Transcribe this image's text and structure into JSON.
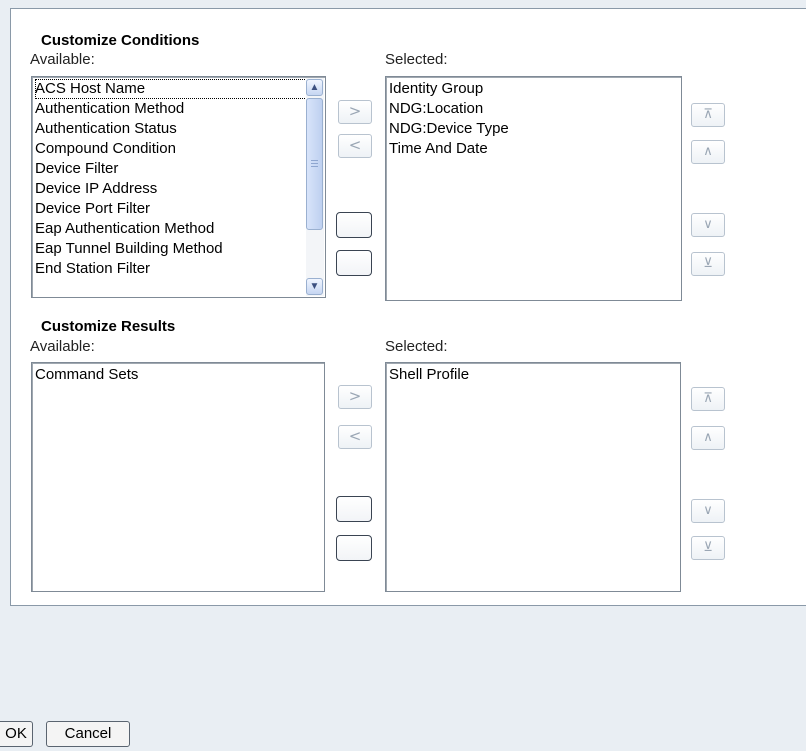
{
  "conditions": {
    "title": "Customize Conditions",
    "available_label": "Available:",
    "selected_label": "Selected:",
    "available_items": [
      "ACS Host Name",
      "Authentication Method",
      "Authentication Status",
      "Compound Condition",
      "Device Filter",
      "Device IP Address",
      "Device Port Filter",
      "Eap Authentication Method",
      "Eap Tunnel Building Method",
      "End Station Filter"
    ],
    "selected_items": [
      "Identity Group",
      "NDG:Location",
      "NDG:Device Type",
      "Time And Date"
    ],
    "focused_item": "ACS Host Name"
  },
  "results": {
    "title": "Customize Results",
    "available_label": "Available:",
    "selected_label": "Selected:",
    "available_items": [
      "Command Sets"
    ],
    "selected_items": [
      "Shell Profile"
    ]
  },
  "buttons": {
    "add": ">",
    "remove": "<",
    "move_top": "⊼",
    "move_up": "∧",
    "move_down": "∨",
    "move_bottom": "⊻"
  },
  "footer": {
    "ok_label": "OK",
    "cancel_label": "Cancel"
  },
  "icons": {
    "scroll_up": "chevron-up-icon",
    "scroll_down": "chevron-down-icon"
  }
}
